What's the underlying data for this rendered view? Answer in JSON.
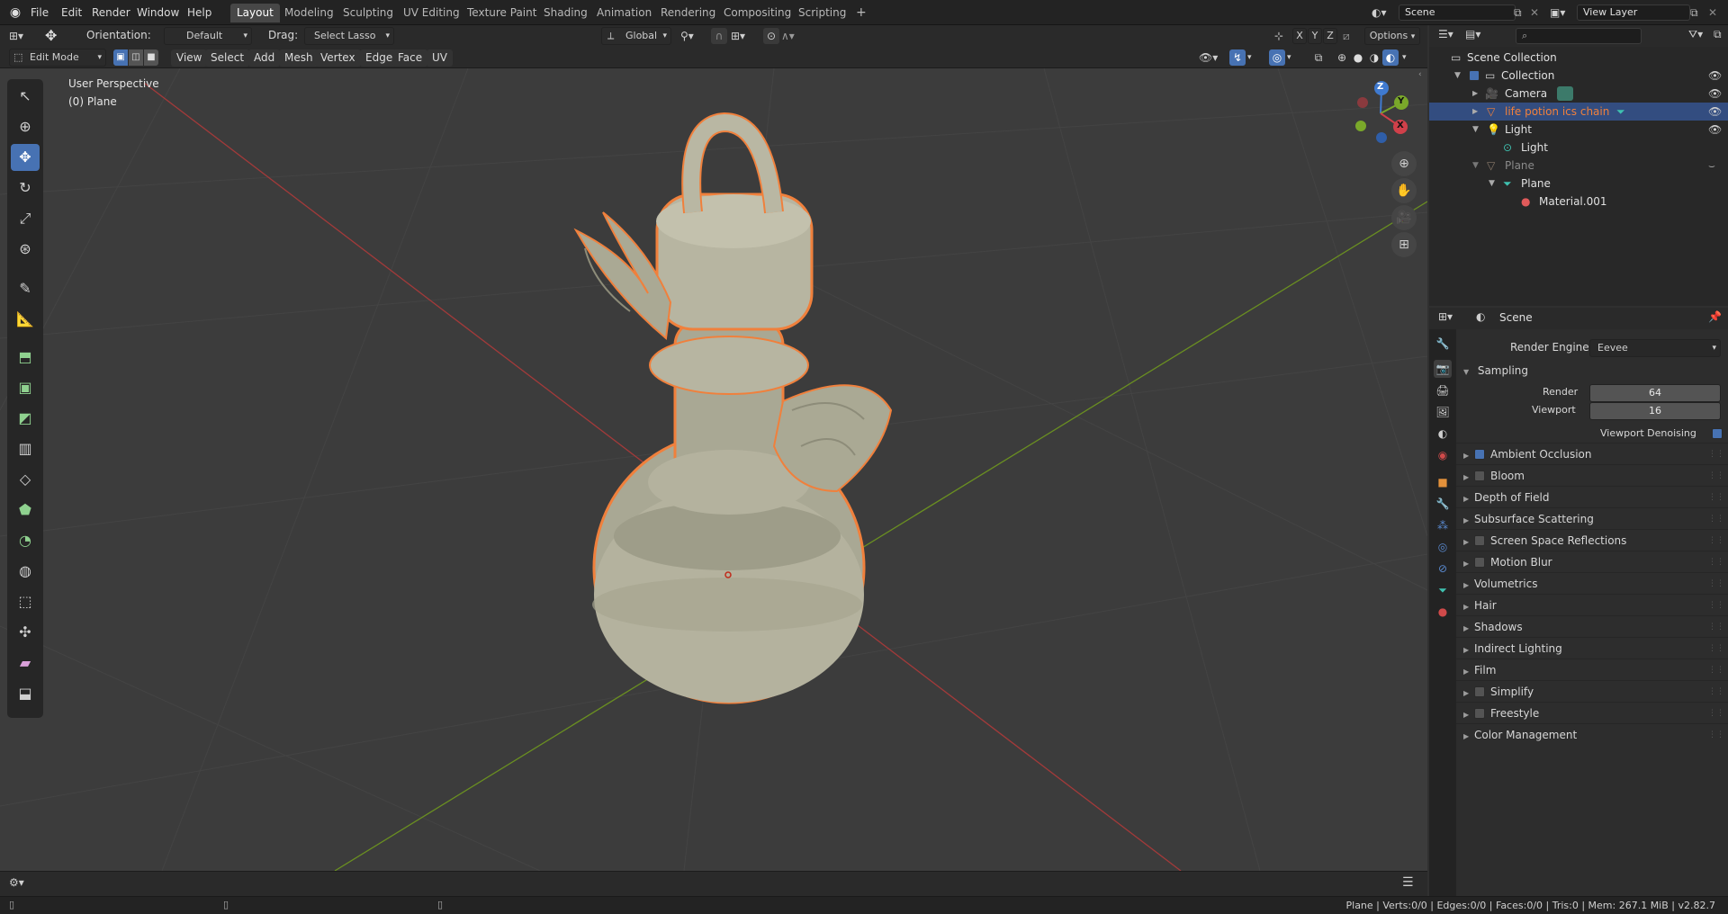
{
  "menus": [
    "File",
    "Edit",
    "Render",
    "Window",
    "Help"
  ],
  "workspaces": [
    "Layout",
    "Modeling",
    "Sculpting",
    "UV Editing",
    "Texture Paint",
    "Shading",
    "Animation",
    "Rendering",
    "Compositing",
    "Scripting",
    "+"
  ],
  "scene_name": "Scene",
  "view_layer": "View Layer",
  "tool_header": {
    "orientation_label": "Orientation:",
    "orientation_value": "Default",
    "drag_label": "Drag:",
    "drag_value": "Select Lasso",
    "transform_orientation": "Global",
    "options": "Options",
    "axis_x": "X",
    "axis_y": "Y",
    "axis_z": "Z"
  },
  "view_header": {
    "mode": "Edit Mode",
    "menus": [
      "View",
      "Select",
      "Add",
      "Mesh",
      "Vertex",
      "Edge",
      "Face",
      "UV"
    ]
  },
  "viewport": {
    "perspective": "User Perspective",
    "object_label": "(0) Plane",
    "gizmo": {
      "x": "X",
      "y": "Y",
      "z": "Z"
    }
  },
  "outliner": {
    "items": [
      {
        "label": "Scene Collection",
        "level": 0,
        "color": "#e0e0e0"
      },
      {
        "label": "Collection",
        "level": 1,
        "color": "#e0e0e0"
      },
      {
        "label": "Camera",
        "level": 2,
        "color": "#e0e0e0"
      },
      {
        "label": "life potion ics chain",
        "level": 2,
        "color": "#f0803c"
      },
      {
        "label": "Light",
        "level": 2,
        "color": "#e0e0e0"
      },
      {
        "label": "Light",
        "level": 3,
        "color": "#e0e0e0"
      },
      {
        "label": "Plane",
        "level": 2,
        "color": "#8a8a8a"
      },
      {
        "label": "Plane",
        "level": 3,
        "color": "#e0e0e0"
      },
      {
        "label": "Material.001",
        "level": 4,
        "color": "#e0e0e0"
      }
    ]
  },
  "properties": {
    "context": "Scene",
    "render_engine_label": "Render Engine",
    "render_engine": "Eevee",
    "sampling_label": "Sampling",
    "render_label": "Render",
    "render_samples": "64",
    "viewport_label": "Viewport",
    "viewport_samples": "16",
    "denoise_label": "Viewport Denoising",
    "panels": [
      {
        "label": "Ambient Occlusion",
        "checkbox": true,
        "checked": true
      },
      {
        "label": "Bloom",
        "checkbox": true,
        "checked": false
      },
      {
        "label": "Depth of Field",
        "checkbox": false
      },
      {
        "label": "Subsurface Scattering",
        "checkbox": false
      },
      {
        "label": "Screen Space Reflections",
        "checkbox": true,
        "checked": false
      },
      {
        "label": "Motion Blur",
        "checkbox": true,
        "checked": false
      },
      {
        "label": "Volumetrics",
        "checkbox": false
      },
      {
        "label": "Hair",
        "checkbox": false
      },
      {
        "label": "Shadows",
        "checkbox": false
      },
      {
        "label": "Indirect Lighting",
        "checkbox": false
      },
      {
        "label": "Film",
        "checkbox": false
      },
      {
        "label": "Simplify",
        "checkbox": true,
        "checked": false
      },
      {
        "label": "Freestyle",
        "checkbox": true,
        "checked": false
      },
      {
        "label": "Color Management",
        "checkbox": false
      }
    ]
  },
  "status_bar": "Plane | Verts:0/0 | Edges:0/0 | Faces:0/0 | Tris:0 | Mem: 267.1 MiB | v2.82.7",
  "colors": {
    "accent": "#4772b3",
    "selection": "#f0803c",
    "x_axis": "#c0393b",
    "y_axis": "#6a9a22"
  }
}
